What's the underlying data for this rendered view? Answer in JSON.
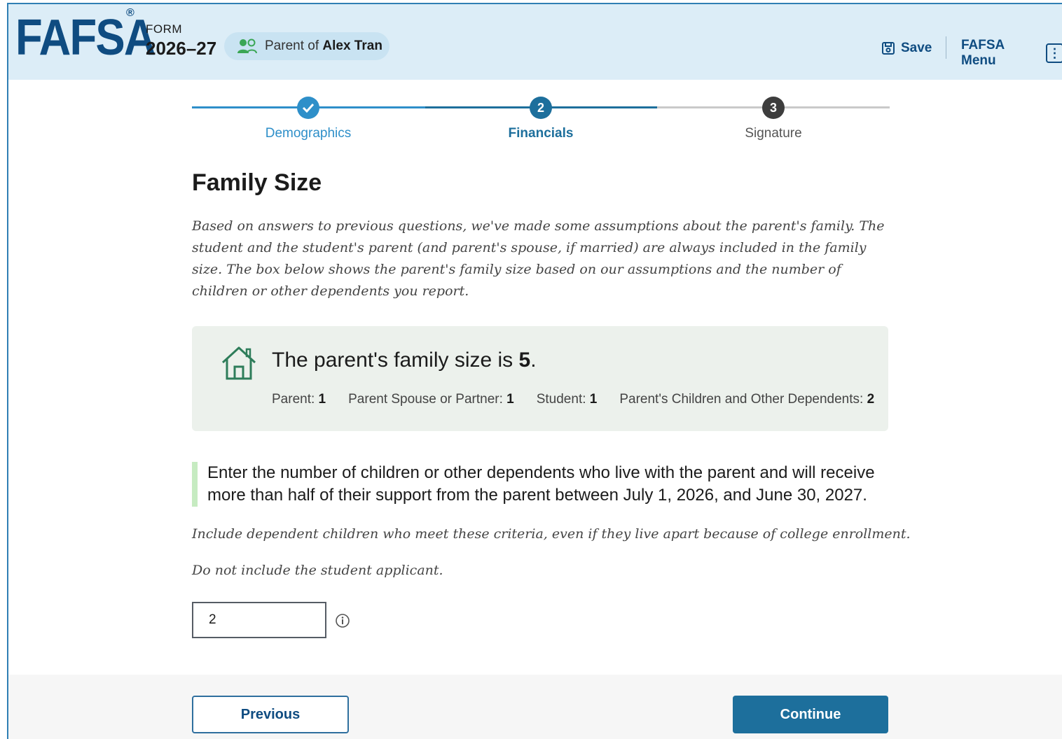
{
  "header": {
    "logo": "FAFSA",
    "logo_reg": "®",
    "form_label": "FORM",
    "form_year": "2026–27",
    "role_prefix": "Parent of",
    "role_name": "Alex Tran",
    "save_label": "Save",
    "menu_label": "FAFSA Menu",
    "menu_dots": "⋮"
  },
  "stepper": {
    "steps": [
      {
        "number": "",
        "label": "Demographics",
        "state": "complete"
      },
      {
        "number": "2",
        "label": "Financials",
        "state": "current"
      },
      {
        "number": "3",
        "label": "Signature",
        "state": "upcoming"
      }
    ]
  },
  "page": {
    "title": "Family Size",
    "intro": "Based on answers to previous questions, we've made some assumptions about the parent's family. The student and the student's parent (and parent's spouse, if married) are always included in the family size. The box below shows the parent's family size based on our assumptions and the number of children or other dependents you report."
  },
  "summary": {
    "title_prefix": "The parent's family size is ",
    "size": "5",
    "title_suffix": ".",
    "items": [
      {
        "label": "Parent: ",
        "value": "1"
      },
      {
        "label": "Parent Spouse or Partner: ",
        "value": "1"
      },
      {
        "label": "Student: ",
        "value": "1"
      },
      {
        "label": "Parent's Children and Other Dependents: ",
        "value": "2"
      }
    ]
  },
  "question": {
    "text": "Enter the number of children or other dependents who live with the parent and will receive more than half of their support from the parent between July 1, 2026, and June 30, 2027.",
    "hint1": "Include dependent children who meet these criteria, even if they live apart because of college enrollment.",
    "hint2": "Do not include the student applicant.",
    "value": "2"
  },
  "footer": {
    "previous_label": "Previous",
    "continue_label": "Continue"
  },
  "colors": {
    "brand": "#0f4c81",
    "header_bg": "#dcedf7",
    "step_complete": "#2e8fc9",
    "step_current": "#1d6f9c",
    "step_upcoming": "#3d3d3d",
    "summary_bg": "#ecf1ec",
    "house_icon": "#2e7d5a",
    "question_bar": "#c6ebc1"
  }
}
